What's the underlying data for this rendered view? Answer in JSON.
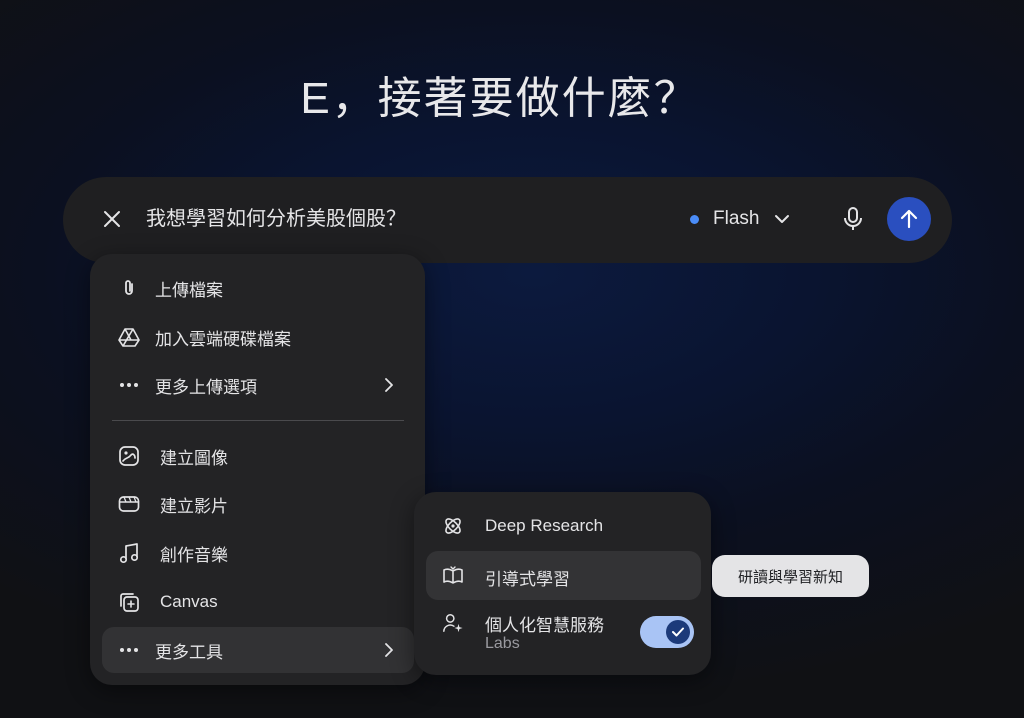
{
  "greeting": "E，接著要做什麼？",
  "prompt": {
    "text": "我想學習如何分析美股個股？",
    "model": "Flash",
    "model_dot_color": "#4a8cf7",
    "close_icon": "close-icon",
    "mic_icon": "mic-icon",
    "send_icon": "arrow-up-icon",
    "send_color": "#2a4fbf"
  },
  "menu": {
    "items": [
      {
        "label": "上傳檔案",
        "icon": "paperclip-icon"
      },
      {
        "label": "加入雲端硬碟檔案",
        "icon": "drive-icon"
      },
      {
        "label": "更多上傳選項",
        "icon": "more-horiz-icon",
        "has_submenu": true
      },
      {
        "label": "建立圖像",
        "icon": "image-icon"
      },
      {
        "label": "建立影片",
        "icon": "video-icon"
      },
      {
        "label": "創作音樂",
        "icon": "music-icon"
      },
      {
        "label": "Canvas",
        "icon": "canvas-icon"
      },
      {
        "label": "更多工具",
        "icon": "more-horiz-icon",
        "has_submenu": true,
        "active": true
      }
    ]
  },
  "submenu": {
    "items": [
      {
        "label": "Deep Research",
        "icon": "deep-research-icon"
      },
      {
        "label": "引導式學習",
        "icon": "book-icon",
        "active": true
      },
      {
        "label": "個人化智慧服務",
        "sublabel": "Labs",
        "icon": "person-sparkle-icon",
        "toggle_on": true
      }
    ]
  },
  "tooltip": "研讀與學習新知"
}
